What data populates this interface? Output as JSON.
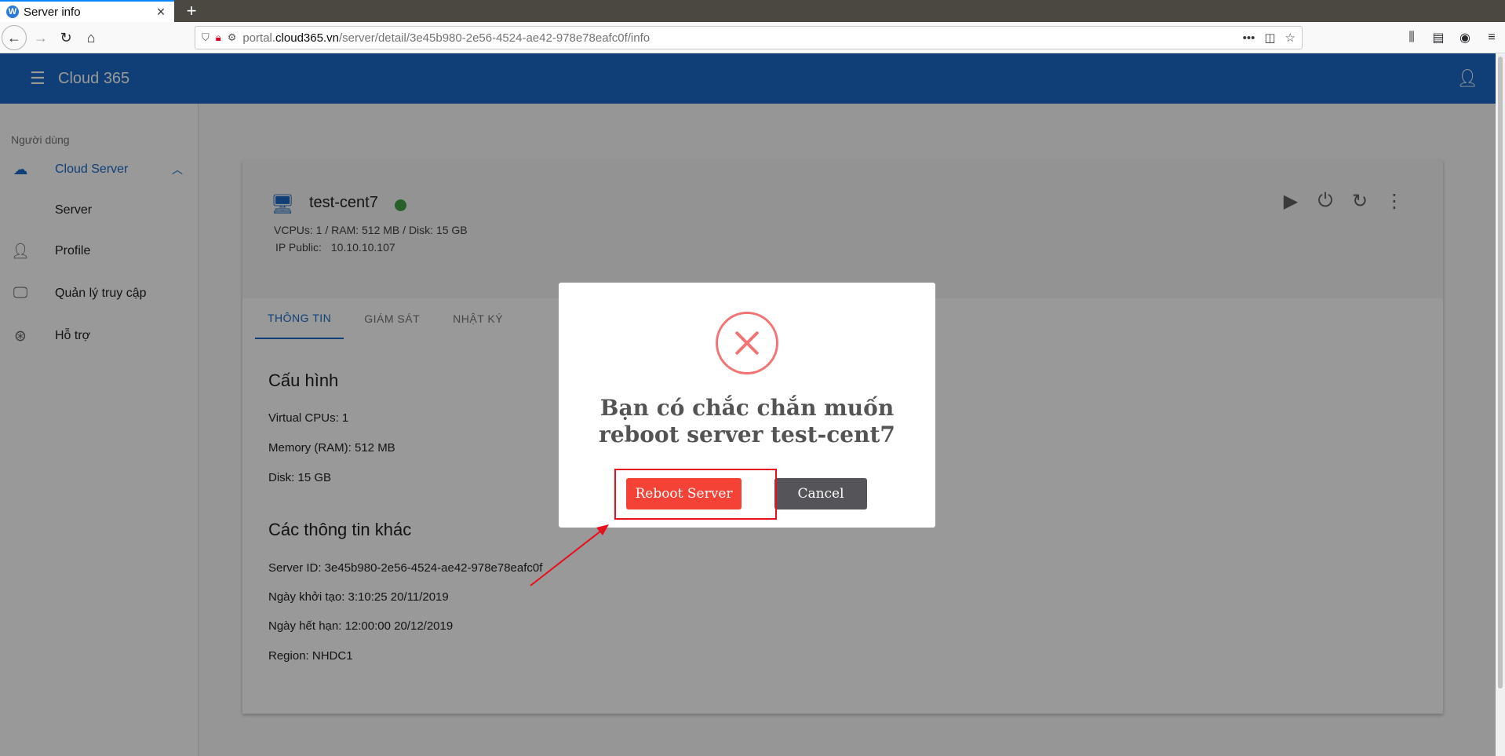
{
  "browser": {
    "tab_title": "Server info",
    "tab_favicon": "W",
    "tab_close": "×",
    "new_tab": "+",
    "url_host": "portal.cloud365.vn",
    "url_path": "/server/detail/3e45b980-2e56-4524-ae42-978e78eafc0f/info",
    "url_prefix": "portal.",
    "url_domain": "cloud365.vn"
  },
  "app": {
    "title": "Cloud 365"
  },
  "sidebar": {
    "section_label": "Người dùng",
    "items": [
      {
        "label": "Cloud Server",
        "icon": "cloud-icon"
      },
      {
        "label": "Server"
      },
      {
        "label": "Profile",
        "icon": "person-icon"
      },
      {
        "label": "Quản lý truy cập",
        "icon": "monitor-access-icon"
      },
      {
        "label": "Hỗ trợ",
        "icon": "lifebuoy-icon"
      }
    ]
  },
  "server": {
    "name": "test-cent7",
    "status_color": "#43a047",
    "specs": "VCPUs: 1 / RAM: 512 MB / Disk: 15 GB",
    "ip_label": "IP Public:",
    "ip_value": "10.10.10.107"
  },
  "tabs": [
    "THÔNG TIN",
    "GIÁM SÁT",
    "NHẬT KÝ"
  ],
  "config": {
    "title": "Cấu hình",
    "lines": [
      "Virtual CPUs: 1",
      "Memory (RAM): 512 MB",
      "Disk: 15 GB"
    ]
  },
  "other_info": {
    "title": "Các thông tin khác",
    "lines": [
      "Server ID: 3e45b980-2e56-4524-ae42-978e78eafc0f",
      "Ngày khởi tạo: 3:10:25 20/11/2019",
      "Ngày hết hạn: 12:00:00 20/12/2019",
      "Region: NHDC1"
    ]
  },
  "modal": {
    "title_line1": "Bạn có chắc chắn muốn",
    "title_line2": "reboot server test-cent7",
    "confirm_label": "Reboot Server",
    "cancel_label": "Cancel"
  },
  "colors": {
    "brand": "#1b69c6",
    "error": "#f27474",
    "confirm": "#f44336",
    "cancel": "#545459",
    "annotation": "#e8101c"
  }
}
